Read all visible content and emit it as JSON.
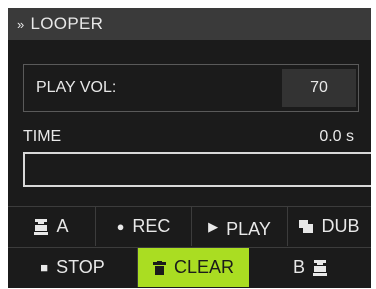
{
  "header": {
    "title": "LOOPER",
    "icon": "double-chevron-right-icon"
  },
  "play_volume": {
    "label": "PLAY VOL:",
    "value": "70"
  },
  "time": {
    "label": "TIME",
    "value": "0.0 s"
  },
  "buttons_row1": [
    {
      "label": "A",
      "icon": "marker-a-icon"
    },
    {
      "label": "REC",
      "icon": "record-dot-icon"
    },
    {
      "label": "PLAY",
      "icon": "play-triangle-icon"
    },
    {
      "label": "DUB",
      "icon": "overdub-icon"
    }
  ],
  "buttons_row2": [
    {
      "label": "STOP",
      "icon": "stop-square-icon"
    },
    {
      "label": "CLEAR",
      "icon": "trash-icon"
    },
    {
      "label": "B",
      "icon": "marker-b-icon"
    }
  ],
  "colors": {
    "panel": "#1b1b1b",
    "header": "#3a3a3a",
    "clear_accent": "#aadd22"
  }
}
